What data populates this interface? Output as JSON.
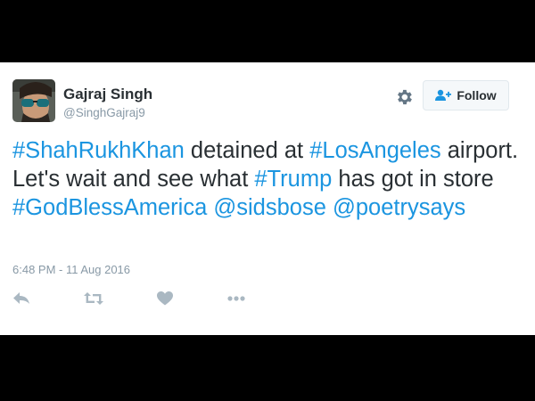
{
  "user": {
    "display_name": "Gajraj Singh",
    "handle": "@SinghGajraj9"
  },
  "follow_button": {
    "label": "Follow"
  },
  "tweet": {
    "segments": [
      {
        "text": "#ShahRukhKhan",
        "kind": "hashtag"
      },
      {
        "text": " detained at ",
        "kind": "text"
      },
      {
        "text": "#LosAngeles",
        "kind": "hashtag"
      },
      {
        "text": " airport. Let's wait and see what ",
        "kind": "text"
      },
      {
        "text": "#Trump",
        "kind": "hashtag"
      },
      {
        "text": " has got in store ",
        "kind": "text"
      },
      {
        "text": "#GodBlessAmerica",
        "kind": "hashtag"
      },
      {
        "text": " ",
        "kind": "text"
      },
      {
        "text": "@sidsbose",
        "kind": "mention"
      },
      {
        "text": " ",
        "kind": "text"
      },
      {
        "text": "@poetrysays",
        "kind": "mention"
      }
    ],
    "timestamp": "6:48 PM - 11 Aug 2016"
  },
  "actions": [
    {
      "name": "reply-icon"
    },
    {
      "name": "retweet-icon"
    },
    {
      "name": "like-icon"
    },
    {
      "name": "more-icon"
    }
  ],
  "colors": {
    "background": "#000000",
    "card": "#ffffff",
    "link": "#1b95e0",
    "text": "#292f33",
    "muted": "#8899a6",
    "icon": "#aab8c2"
  }
}
